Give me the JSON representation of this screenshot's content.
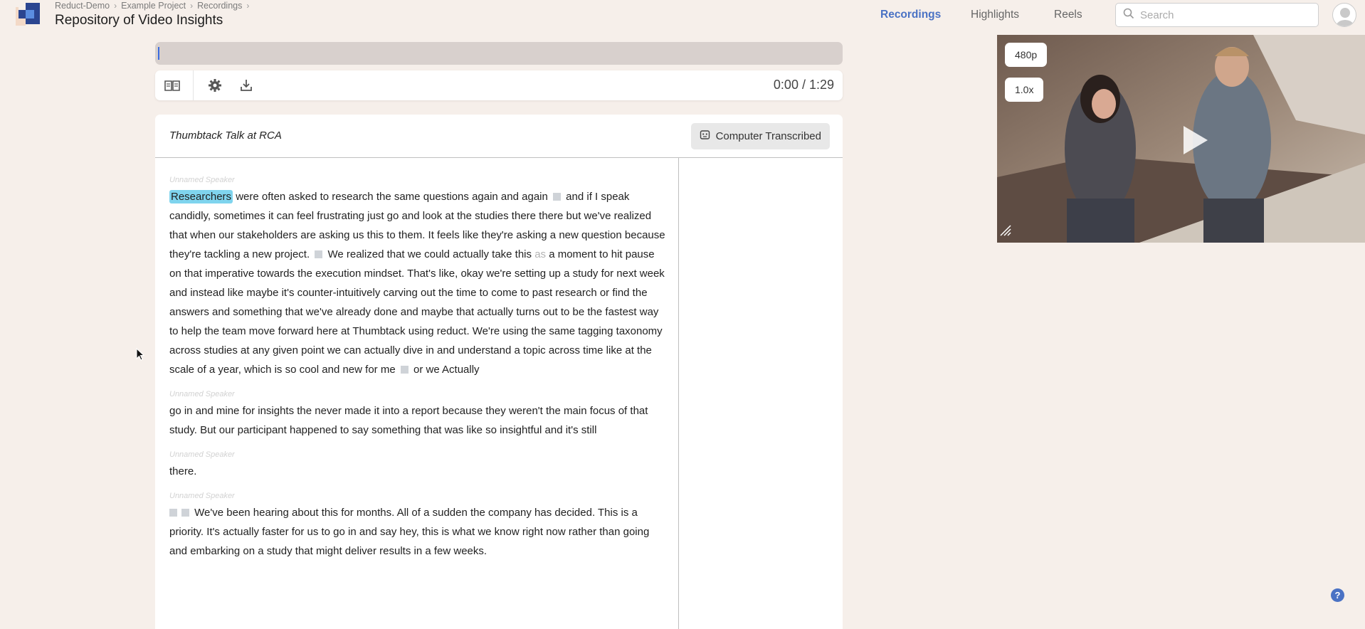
{
  "header": {
    "breadcrumb": [
      "Reduct-Demo",
      "Example Project",
      "Recordings"
    ],
    "title": "Repository of Video Insights",
    "nav": [
      {
        "label": "Recordings",
        "active": true
      },
      {
        "label": "Highlights",
        "active": false
      },
      {
        "label": "Reels",
        "active": false
      }
    ],
    "search_placeholder": "Search",
    "search_value": ""
  },
  "player": {
    "time": "0:00 / 1:29",
    "resolution": "480p",
    "speed": "1.0x",
    "icons": [
      "book-icon",
      "gear-icon",
      "download-icon"
    ]
  },
  "transcript": {
    "title": "Thumbtack Talk at RCA",
    "badge": "Computer Transcribed",
    "segments": [
      {
        "speaker": "Unnamed Speaker",
        "highlight": "Researchers",
        "t1": " were often asked to research the same questions again and again ",
        "t2": " and if I speak candidly, sometimes it can feel frustrating just go and look at the studies there there but we've realized that when our stakeholders are asking us this to them. It feels like they're asking a new question because they're tackling a new project. ",
        "t3": " We realized that we could actually take this ",
        "faded": "as",
        "t4": " a moment to hit pause on that imperative towards the execution mindset. That's like, okay we're setting up a study for next week and instead like maybe it's counter-intuitively carving out the time to come to past research or find the answers and something that we've already done and maybe that actually turns out to be the fastest way to help the team move forward here at Thumbtack using reduct. We're using the same tagging taxonomy across studies at any given point we can actually dive in and understand a topic across time like at the scale of a year, which is so cool and new for me ",
        "t5": " or we Actually"
      },
      {
        "speaker": "Unnamed Speaker",
        "text": "go in and mine for insights the never made it into a report because they weren't the main focus of that study. But our participant happened to say something that was like so insightful and it's still"
      },
      {
        "speaker": "Unnamed Speaker",
        "text": "there."
      },
      {
        "speaker": "Unnamed Speaker",
        "text": " We've been hearing about this for months. All of a sudden the company has decided. This is a priority. It's actually faster for us to go in and say hey, this is what we know right now rather than going and embarking on a study that might deliver results in a few weeks."
      }
    ]
  },
  "help_label": "?",
  "colors": {
    "accent": "#4a72c4",
    "highlight": "#7fd4ee",
    "background": "#f6efea"
  }
}
